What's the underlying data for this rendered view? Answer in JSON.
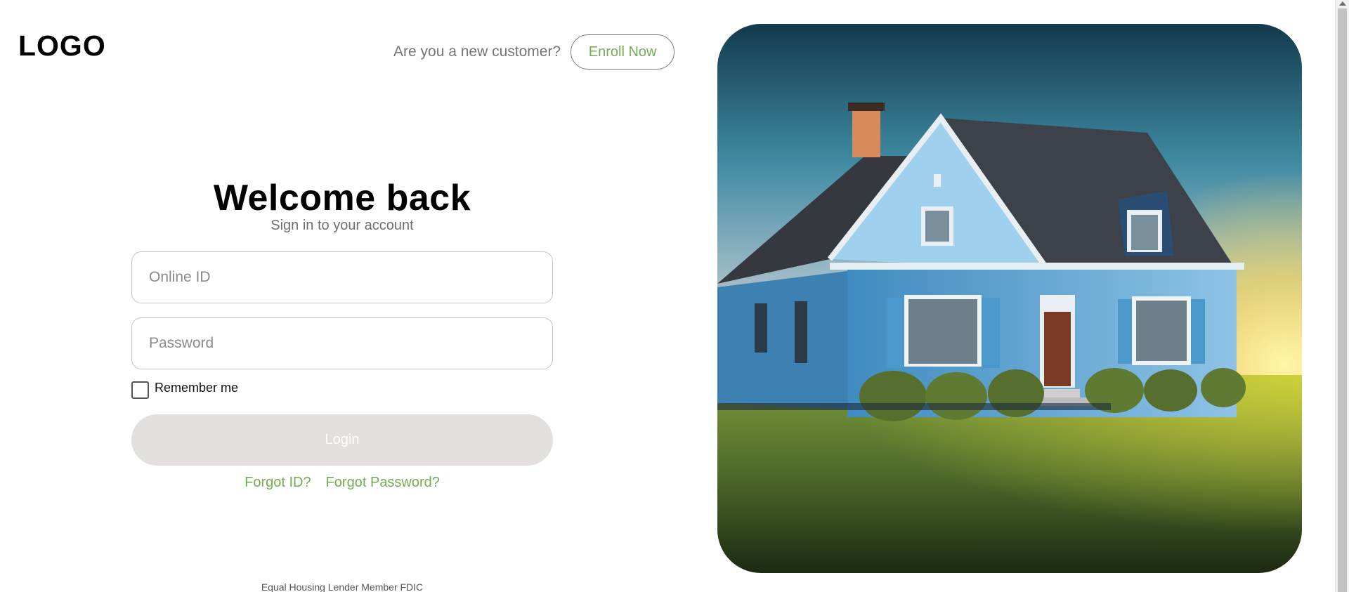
{
  "header": {
    "logo_text": "LOGO",
    "enroll_prompt": "Are you a new customer?",
    "enroll_button_label": "Enroll Now"
  },
  "login_form": {
    "title": "Welcome back",
    "subtitle": "Sign in to your account",
    "online_id": {
      "value": "",
      "placeholder": "Online ID"
    },
    "password": {
      "value": "",
      "placeholder": "Password"
    },
    "remember_me": {
      "label": "Remember me",
      "checked": false
    },
    "login_button_label": "Login",
    "forgot_id_label": "Forgot ID?",
    "forgot_password_label": "Forgot Password?"
  },
  "footer": {
    "note": "Equal Housing Lender Member FDIC"
  },
  "hero": {
    "icon": "house-illustration"
  },
  "colors": {
    "accent": "#73ac55",
    "login_button_bg": "#e2dfde",
    "border": "#c4c4c4",
    "muted_text": "#757575"
  }
}
